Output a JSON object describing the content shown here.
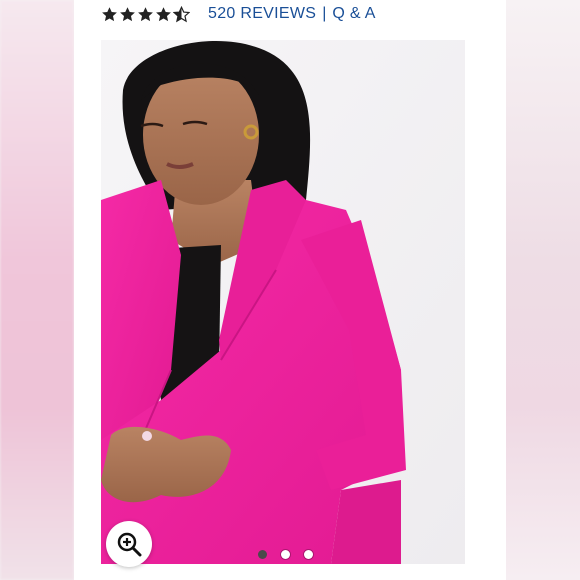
{
  "rating": {
    "value": 4.5,
    "max": 5,
    "reviews_label": "520 REVIEWS",
    "separator": "|",
    "qa_label": "Q & A"
  },
  "gallery": {
    "image_count": 3,
    "active_index": 0,
    "zoom_icon": "zoom-in-icon"
  },
  "colors": {
    "link": "#1a4f97",
    "blazer": "#f0249f",
    "star": "#222222"
  }
}
